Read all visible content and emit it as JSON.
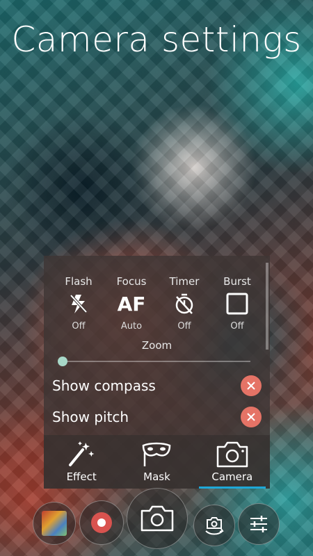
{
  "header": {
    "title": "Camera settings"
  },
  "settings": {
    "modes": [
      {
        "label": "Flash",
        "value": "Off",
        "icon": "flash-off-icon"
      },
      {
        "label": "Focus",
        "value": "Auto",
        "icon_text": "AF",
        "icon": "autofocus-icon"
      },
      {
        "label": "Timer",
        "value": "Off",
        "icon": "timer-off-icon"
      },
      {
        "label": "Burst",
        "value": "Off",
        "icon": "burst-square-icon"
      }
    ],
    "zoom_label": "Zoom",
    "zoom_level": 0,
    "toggles": [
      {
        "label": "Show compass",
        "state": "off"
      },
      {
        "label": "Show pitch",
        "state": "off"
      }
    ]
  },
  "tabs": [
    {
      "label": "Effect",
      "icon": "magic-wand-icon",
      "active": false
    },
    {
      "label": "Mask",
      "icon": "mask-icon",
      "active": false
    },
    {
      "label": "Camera",
      "icon": "camera-icon",
      "active": true
    }
  ],
  "colors": {
    "accent": "#1ea8d8",
    "toggle_off": "#e57366",
    "slider_knob": "#a8d8c8"
  },
  "bottom_controls": [
    "gallery-thumbnail",
    "record-button",
    "shutter-button",
    "switch-camera-button",
    "settings-button"
  ]
}
